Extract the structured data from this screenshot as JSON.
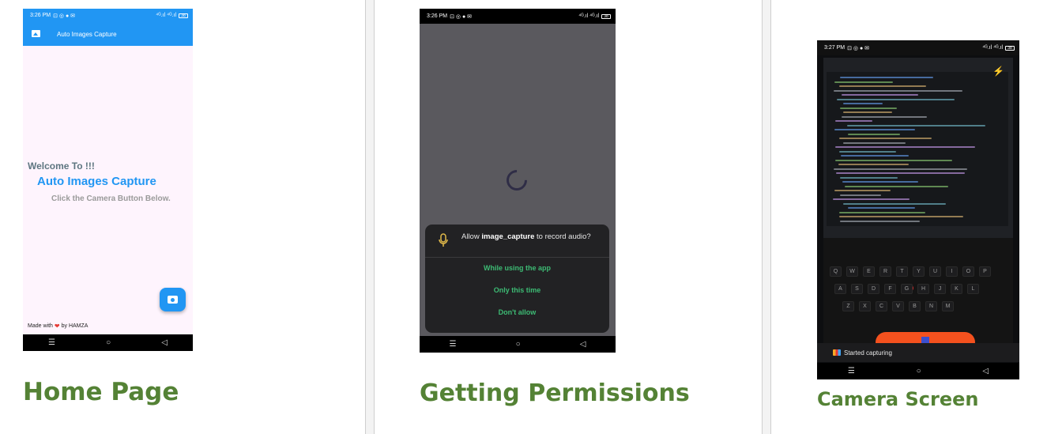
{
  "home": {
    "status_time": "3:26 PM",
    "status_icons": "⊡ ◎ ● ✉",
    "status_right": "⁴ᴳ.ıl ⁴ᴳ.ıl",
    "battery": "38",
    "appbar_title": "Auto Images Capture",
    "welcome": "Welcome To !!!",
    "app_name": "Auto Images Capture",
    "hint": "Click the Camera Button Below.",
    "footer_pre": "Made with",
    "footer_post": "by HAMZA",
    "caption": "Home Page"
  },
  "permissions": {
    "status_time": "3:26 PM",
    "status_icons": "⊡ ◎ ● ✉",
    "status_right": "⁴ᴳ.ıl ⁴ᴳ.ıl",
    "battery": "38",
    "prompt_pre": "Allow",
    "prompt_app": "image_capture",
    "prompt_post": "to record audio?",
    "option_1": "While using the app",
    "option_2": "Only this time",
    "option_3": "Don't allow",
    "caption": "Getting Permissions"
  },
  "camera": {
    "status_time": "3:27 PM",
    "status_icons": "⊡ ◎ ● ✉",
    "status_right": "⁴ᴳ.ıl ⁴ᴳ.ıl",
    "battery": "38",
    "toast": "Started capturing",
    "caption": "Camera Screen"
  },
  "nav": {
    "menu": "☰",
    "home": "○",
    "back": "◁"
  },
  "keyboard": {
    "row1": [
      "Q",
      "W",
      "E",
      "R",
      "T",
      "Y",
      "U",
      "I",
      "O",
      "P"
    ],
    "row2": [
      "A",
      "S",
      "D",
      "F",
      "G",
      "H",
      "J",
      "K",
      "L"
    ],
    "row3": [
      "Z",
      "X",
      "C",
      "V",
      "B",
      "N",
      "M"
    ]
  }
}
